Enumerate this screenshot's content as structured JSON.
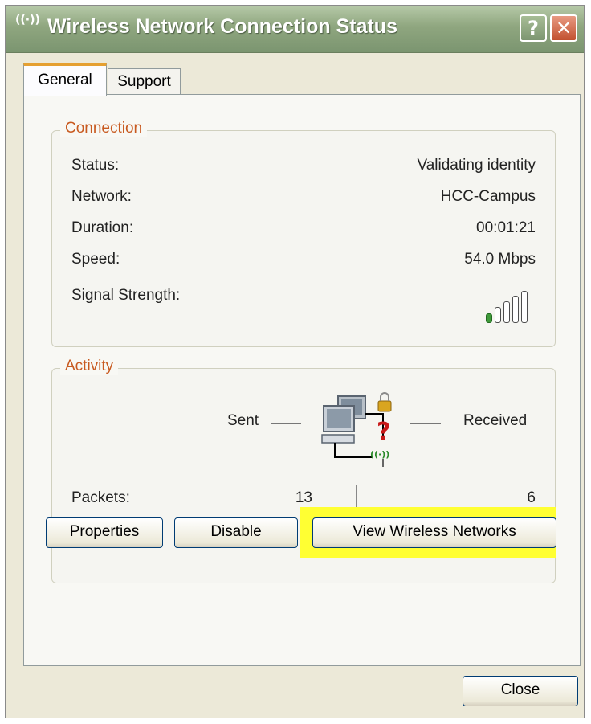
{
  "window": {
    "title": "Wireless Network Connection Status",
    "title_icon": "((·))",
    "help_glyph": "?",
    "close_glyph": "✕"
  },
  "tabs": [
    {
      "label": "General",
      "active": true
    },
    {
      "label": "Support",
      "active": false
    }
  ],
  "connection": {
    "legend": "Connection",
    "rows": [
      {
        "label": "Status:",
        "value": "Validating identity"
      },
      {
        "label": "Network:",
        "value": "HCC-Campus"
      },
      {
        "label": "Duration:",
        "value": "00:01:21"
      },
      {
        "label": "Speed:",
        "value": "54.0 Mbps"
      }
    ],
    "signal_label": "Signal Strength:",
    "signal_bars_total": 5,
    "signal_bars_filled": 1
  },
  "activity": {
    "legend": "Activity",
    "sent_label": "Sent",
    "received_label": "Received",
    "packets_label": "Packets:",
    "packets_sent": "13",
    "packets_received": "6",
    "wifi_glyph": "((·))"
  },
  "buttons": {
    "properties": "Properties",
    "disable": "Disable",
    "view_wireless": "View Wireless Networks",
    "close": "Close"
  },
  "colors": {
    "legend": "#c85a20",
    "highlight": "#ffff33",
    "signal_on": "#3f9a3a",
    "tab_accent": "#e5a031"
  }
}
